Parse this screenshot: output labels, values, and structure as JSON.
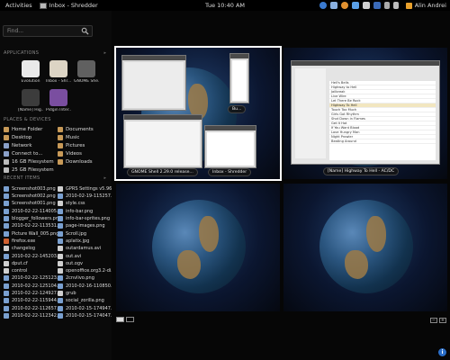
{
  "topbar": {
    "activities": "Activities",
    "app_name": "Inbox - Shredder",
    "clock": "Tue 10:40 AM",
    "user": "Alin Andrei"
  },
  "sidebar": {
    "search_placeholder": "Find...",
    "applications_title": "APPLICATIONS",
    "applications": [
      {
        "label": "Evolution",
        "color": "#e9e9e9"
      },
      {
        "label": "Inbox - Shr...",
        "color": "#dcd4c4"
      },
      {
        "label": "GNOME She...",
        "color": "#606060"
      },
      {
        "label": "[Name] Hig...",
        "color": "#3c3c3c"
      },
      {
        "label": "Pidgin Inter...",
        "color": "#7a4ea0"
      }
    ],
    "places_title": "PLACES & DEVICES",
    "places": [
      {
        "label": "Home Folder",
        "color": "#c89a58"
      },
      {
        "label": "Documents",
        "color": "#c89a58"
      },
      {
        "label": "Desktop",
        "color": "#c89a58"
      },
      {
        "label": "Music",
        "color": "#c89a58"
      },
      {
        "label": "Network",
        "color": "#8aa0c8"
      },
      {
        "label": "Pictures",
        "color": "#c89a58"
      },
      {
        "label": "Connect to...",
        "color": "#8aa0c8"
      },
      {
        "label": "Videos",
        "color": "#c89a58"
      },
      {
        "label": "16 GB Filesystem",
        "color": "#bbbbbb"
      },
      {
        "label": "Downloads",
        "color": "#c89a58"
      },
      {
        "label": "25 GB Filesystem",
        "color": "#bbbbbb"
      }
    ],
    "recent_title": "RECENT ITEMS",
    "recent": [
      {
        "label": "Screenshot003.png",
        "color": "#7aa0d0"
      },
      {
        "label": "GPRS Settings v5.96...",
        "color": "#cfcfcf"
      },
      {
        "label": "Screenshot002.png",
        "color": "#7aa0d0"
      },
      {
        "label": "2010-02-19-115257...",
        "color": "#7aa0d0"
      },
      {
        "label": "Screenshot001.png",
        "color": "#7aa0d0"
      },
      {
        "label": "style.css",
        "color": "#cfcfcf"
      },
      {
        "label": "2010-02-22-114005...",
        "color": "#7aa0d0"
      },
      {
        "label": "info-bar.png",
        "color": "#7aa0d0"
      },
      {
        "label": "blogger_followers.png",
        "color": "#7aa0d0"
      },
      {
        "label": "info-bar-sprites.png",
        "color": "#7aa0d0"
      },
      {
        "label": "2010-02-22-113531...",
        "color": "#7aa0d0"
      },
      {
        "label": "page-images.png",
        "color": "#7aa0d0"
      },
      {
        "label": "Picture Wall_005.png",
        "color": "#7aa0d0"
      },
      {
        "label": "Scroll.jpg",
        "color": "#7aa0d0"
      },
      {
        "label": "firefox.exe",
        "color": "#d06030"
      },
      {
        "label": "aplatix.jpg",
        "color": "#7aa0d0"
      },
      {
        "label": "changelog",
        "color": "#cfcfcf"
      },
      {
        "label": "outardamus.avi",
        "color": "#cfcfcf"
      },
      {
        "label": "2010-02-22-145203...",
        "color": "#7aa0d0"
      },
      {
        "label": "out.avi",
        "color": "#cfcfcf"
      },
      {
        "label": "dput.cf",
        "color": "#cfcfcf"
      },
      {
        "label": "out.ogv",
        "color": "#cfcfcf"
      },
      {
        "label": "control",
        "color": "#cfcfcf"
      },
      {
        "label": "openoffice.org3.2-di...",
        "color": "#cfcfcf"
      },
      {
        "label": "2010-02-22-125123...",
        "color": "#7aa0d0"
      },
      {
        "label": "2cnvlivo.png",
        "color": "#7aa0d0"
      },
      {
        "label": "2010-02-22-125104...",
        "color": "#7aa0d0"
      },
      {
        "label": "2010-02-16-110850...",
        "color": "#7aa0d0"
      },
      {
        "label": "2010-02-22-124927...",
        "color": "#7aa0d0"
      },
      {
        "label": "grub",
        "color": "#cfcfcf"
      },
      {
        "label": "2010-02-22-115944...",
        "color": "#7aa0d0"
      },
      {
        "label": "social_zorilla.png",
        "color": "#7aa0d0"
      },
      {
        "label": "2010-02-22-112657...",
        "color": "#7aa0d0"
      },
      {
        "label": "2010-02-15-174947...",
        "color": "#7aa0d0"
      },
      {
        "label": "2010-02-22-112342...",
        "color": "#7aa0d0"
      },
      {
        "label": "2010-02-15-174047...",
        "color": "#7aa0d0"
      }
    ]
  },
  "workspaces": {
    "windows": {
      "gnome_shell": "GNOME Shell 2.29.0 release...",
      "inbox": "Inbox - Shredder",
      "highway": "[Name] Highway To Hell - AC/DC",
      "bu": "Bu..."
    },
    "music_rows": [
      "Hell's Bells",
      "Highway to Hell",
      "Jailbreak",
      "Live Wire",
      "Let There Be Rock",
      "Highway To Hell",
      "Touch Too Much",
      "Girls Got Rhythm",
      "Shot Down in Flames",
      "Get It Hot",
      "If You Want Blood",
      "Love Hungry Man",
      "Night Prowler",
      "Beating Around"
    ]
  },
  "controls": {
    "minus": "−",
    "plus": "+",
    "info": "i"
  }
}
